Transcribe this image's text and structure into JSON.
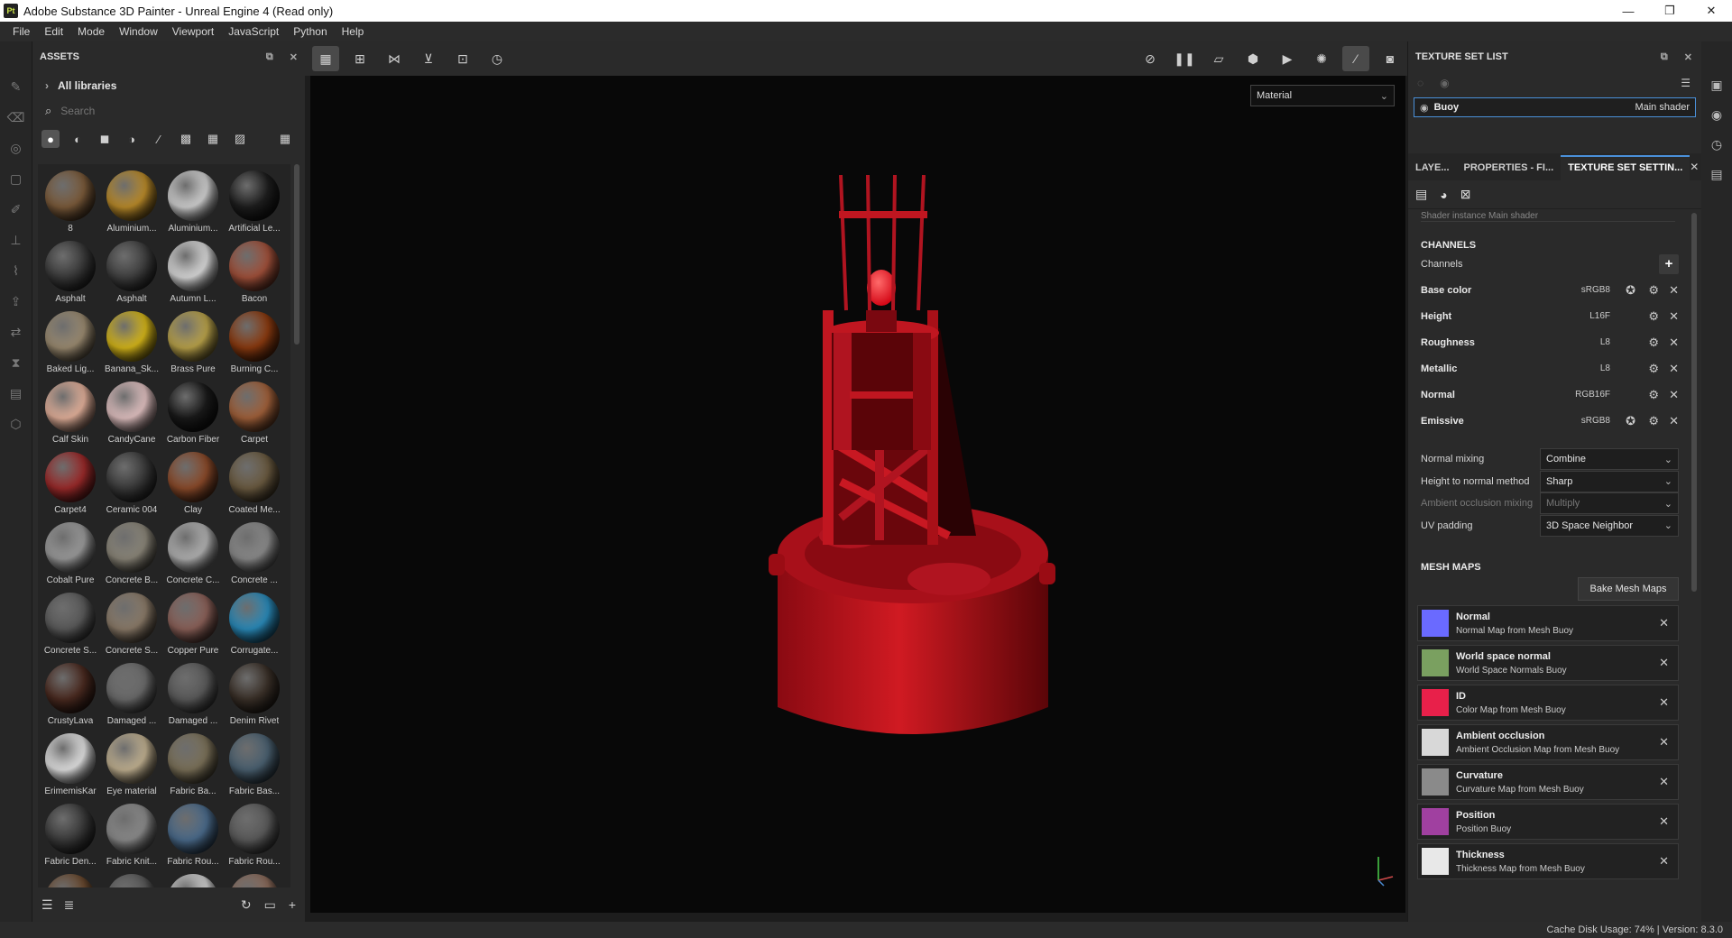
{
  "window": {
    "app_icon_text": "Pt",
    "title": "Adobe Substance 3D Painter - Unreal Engine 4 (Read only)",
    "minimize": "—",
    "restore": "❐",
    "close": "✕"
  },
  "menu": [
    "File",
    "Edit",
    "Mode",
    "Window",
    "Viewport",
    "JavaScript",
    "Python",
    "Help"
  ],
  "assets": {
    "title": "ASSETS",
    "library": "All libraries",
    "search_placeholder": "Search",
    "materials": [
      {
        "label": "8",
        "color": "#7a5a3a"
      },
      {
        "label": "Aluminium...",
        "color": "#b98a2a"
      },
      {
        "label": "Aluminium...",
        "color": "#cfcfcf"
      },
      {
        "label": "Artificial Le...",
        "color": "#1e1e1e"
      },
      {
        "label": "Asphalt",
        "color": "#3a3a3a"
      },
      {
        "label": "Asphalt",
        "color": "#404040"
      },
      {
        "label": "Autumn L...",
        "color": "#d8d8d8"
      },
      {
        "label": "Bacon",
        "color": "#a0503a"
      },
      {
        "label": "Baked Lig...",
        "color": "#9a8a70"
      },
      {
        "label": "Banana_Sk...",
        "color": "#d4b51a"
      },
      {
        "label": "Brass Pure",
        "color": "#b9a24a"
      },
      {
        "label": "Burning C...",
        "color": "#8a3a10"
      },
      {
        "label": "Calf Skin",
        "color": "#e2b09a"
      },
      {
        "label": "CandyCane",
        "color": "#e0c0c0"
      },
      {
        "label": "Carbon Fiber",
        "color": "#1a1a1a"
      },
      {
        "label": "Carpet",
        "color": "#a0603a"
      },
      {
        "label": "Carpet4",
        "color": "#9a2a2a"
      },
      {
        "label": "Ceramic 004",
        "color": "#3a3a3a"
      },
      {
        "label": "Clay",
        "color": "#8a4a2a"
      },
      {
        "label": "Coated Me...",
        "color": "#6a5a40"
      },
      {
        "label": "Cobalt Pure",
        "color": "#9a9a9a"
      },
      {
        "label": "Concrete B...",
        "color": "#8a8578"
      },
      {
        "label": "Concrete C...",
        "color": "#b0b0b0"
      },
      {
        "label": "Concrete ...",
        "color": "#8a8a8a"
      },
      {
        "label": "Concrete S...",
        "color": "#5a5a5a"
      },
      {
        "label": "Concrete S...",
        "color": "#8a7a68"
      },
      {
        "label": "Copper Pure",
        "color": "#8a6058"
      },
      {
        "label": "Corrugate...",
        "color": "#2a8ab9"
      },
      {
        "label": "CrustyLava",
        "color": "#4a2a20"
      },
      {
        "label": "Damaged ...",
        "color": "#6a6a6a"
      },
      {
        "label": "Damaged ...",
        "color": "#5a5a5a"
      },
      {
        "label": "Denim Rivet",
        "color": "#3a3028"
      },
      {
        "label": "ErimemisKar",
        "color": "#e0e0e0"
      },
      {
        "label": "Eye material",
        "color": "#c0b090"
      },
      {
        "label": "Fabric Ba...",
        "color": "#7a7058"
      },
      {
        "label": "Fabric Bas...",
        "color": "#4a6070"
      },
      {
        "label": "Fabric Den...",
        "color": "#3a3a3a"
      },
      {
        "label": "Fabric Knit...",
        "color": "#8a8a8a"
      },
      {
        "label": "Fabric Rou...",
        "color": "#4a6a8a"
      },
      {
        "label": "Fabric Rou...",
        "color": "#5a5a5a"
      },
      {
        "label": "",
        "color": "#6a4a30"
      },
      {
        "label": "",
        "color": "#5a5a5a"
      },
      {
        "label": "",
        "color": "#d0d0d0"
      },
      {
        "label": "",
        "color": "#8a6a5a"
      }
    ]
  },
  "viewport": {
    "display_mode": "Material"
  },
  "texture_set_list": {
    "title": "TEXTURE SET LIST",
    "item_name": "Buoy",
    "item_shader": "Main shader"
  },
  "tabs": {
    "layers": "LAYE...",
    "properties": "PROPERTIES - FI...",
    "texture_set_settings": "TEXTURE SET SETTIN..."
  },
  "tss": {
    "shader_instance_cut": "Shader instance      Main shader",
    "channels_header": "CHANNELS",
    "channels_label": "Channels",
    "channels": [
      {
        "name": "Base color",
        "format": "sRGB8",
        "icon": "✪"
      },
      {
        "name": "Height",
        "format": "L16F",
        "icon": ""
      },
      {
        "name": "Roughness",
        "format": "L8",
        "icon": ""
      },
      {
        "name": "Metallic",
        "format": "L8",
        "icon": ""
      },
      {
        "name": "Normal",
        "format": "RGB16F",
        "icon": ""
      },
      {
        "name": "Emissive",
        "format": "sRGB8",
        "icon": "✪"
      }
    ],
    "settings": [
      {
        "label": "Normal mixing",
        "value": "Combine"
      },
      {
        "label": "Height to normal method",
        "value": "Sharp"
      },
      {
        "label": "Ambient occlusion mixing",
        "value": "Multiply"
      },
      {
        "label": "UV padding",
        "value": "3D Space Neighbor"
      }
    ],
    "mesh_maps_header": "MESH MAPS",
    "bake_button": "Bake Mesh Maps",
    "mesh_maps": [
      {
        "title": "Normal",
        "sub": "Normal Map from Mesh Buoy",
        "color": "#6a6aff"
      },
      {
        "title": "World space normal",
        "sub": "World Space Normals Buoy",
        "color": "#7aa060"
      },
      {
        "title": "ID",
        "sub": "Color Map from Mesh Buoy",
        "color": "#e8204a"
      },
      {
        "title": "Ambient occlusion",
        "sub": "Ambient Occlusion Map from Mesh Buoy",
        "color": "#d8d8d8"
      },
      {
        "title": "Curvature",
        "sub": "Curvature Map from Mesh Buoy",
        "color": "#8a8a8a"
      },
      {
        "title": "Position",
        "sub": "Position Buoy",
        "color": "#a040a0"
      },
      {
        "title": "Thickness",
        "sub": "Thickness Map from Mesh Buoy",
        "color": "#e8e8e8"
      }
    ]
  },
  "status": {
    "text": "Cache Disk Usage:  74% | Version: 8.3.0"
  },
  "colors": {
    "accent": "#4a90d9",
    "buoy_red": "#c0101a"
  }
}
